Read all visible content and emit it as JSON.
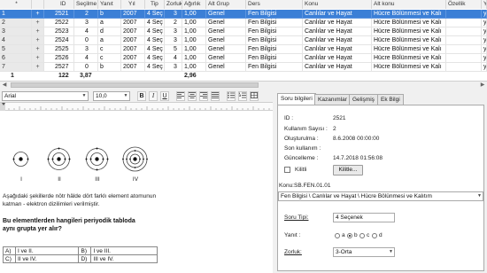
{
  "grid": {
    "headers": [
      "*",
      "ID",
      "Seçilme",
      "Yanıt",
      "Yıl",
      "Tip",
      "Zorluk",
      "Ağırlık",
      "Alt Grup",
      "Ders",
      "Konu",
      "Alt konu",
      "Özellik",
      "Y"
    ],
    "rows": [
      {
        "idx": "1",
        "plus": "+",
        "id": "2521",
        "secilme": "2",
        "yanit": "b",
        "yil": "2007",
        "tip": "4 Seç",
        "zorluk": "3",
        "agirlik": "1,00",
        "altgrup": "Genel",
        "ders": "Fen Bilgisi",
        "konu": "Canlılar ve Hayat",
        "altkonu": "Hücre Bölünmesi ve Kalı",
        "ozellik": "",
        "y": "ya"
      },
      {
        "idx": "2",
        "plus": "+",
        "id": "2522",
        "secilme": "3",
        "yanit": "a",
        "yil": "2007",
        "tip": "4 Seç",
        "zorluk": "2",
        "agirlik": "1,00",
        "altgrup": "Genel",
        "ders": "Fen Bilgisi",
        "konu": "Canlılar ve Hayat",
        "altkonu": "Hücre Bölünmesi ve Kalı",
        "ozellik": "",
        "y": "ya"
      },
      {
        "idx": "3",
        "plus": "+",
        "id": "2523",
        "secilme": "4",
        "yanit": "d",
        "yil": "2007",
        "tip": "4 Seç",
        "zorluk": "3",
        "agirlik": "1,00",
        "altgrup": "Genel",
        "ders": "Fen Bilgisi",
        "konu": "Canlılar ve Hayat",
        "altkonu": "Hücre Bölünmesi ve Kalı",
        "ozellik": "",
        "y": "ya"
      },
      {
        "idx": "4",
        "plus": "+",
        "id": "2524",
        "secilme": "0",
        "yanit": "a",
        "yil": "2007",
        "tip": "4 Seç",
        "zorluk": "3",
        "agirlik": "1,00",
        "altgrup": "Genel",
        "ders": "Fen Bilgisi",
        "konu": "Canlılar ve Hayat",
        "altkonu": "Hücre Bölünmesi ve Kalı",
        "ozellik": "",
        "y": "ya"
      },
      {
        "idx": "5",
        "plus": "+",
        "id": "2525",
        "secilme": "3",
        "yanit": "c",
        "yil": "2007",
        "tip": "4 Seç",
        "zorluk": "5",
        "agirlik": "1,00",
        "altgrup": "Genel",
        "ders": "Fen Bilgisi",
        "konu": "Canlılar ve Hayat",
        "altkonu": "Hücre Bölünmesi ve Kalı",
        "ozellik": "",
        "y": "ya"
      },
      {
        "idx": "6",
        "plus": "+",
        "id": "2526",
        "secilme": "4",
        "yanit": "c",
        "yil": "2007",
        "tip": "4 Seç",
        "zorluk": "4",
        "agirlik": "1,00",
        "altgrup": "Genel",
        "ders": "Fen Bilgisi",
        "konu": "Canlılar ve Hayat",
        "altkonu": "Hücre Bölünmesi ve Kalı",
        "ozellik": "",
        "y": "ya"
      },
      {
        "idx": "7",
        "plus": "+",
        "id": "2527",
        "secilme": "0",
        "yanit": "b",
        "yil": "2007",
        "tip": "4 Seç",
        "zorluk": "3",
        "agirlik": "1,00",
        "altgrup": "Genel",
        "ders": "Fen Bilgisi",
        "konu": "Canlılar ve Hayat",
        "altkonu": "Hücre Bölünmesi ve Kalı",
        "ozellik": "",
        "y": "ya"
      }
    ],
    "totals": {
      "idx": "1",
      "id": "122",
      "secilme": "3,87",
      "agirlik": "2,96"
    },
    "selected_row": 0
  },
  "editor": {
    "font": "Arial",
    "size": "10,0",
    "bold": "B",
    "italic": "I",
    "underline": "U",
    "atom_labels": [
      "I",
      "II",
      "III",
      "IV"
    ],
    "stem": "Aşağıdaki şekillerde nötr hâlde dört farklı element atomunun katman - elektron dizilimleri verilmiştir.",
    "question": "Bu elementlerden hangileri periyodik tabloda aynı grupta yer alır?",
    "options": [
      [
        "A)",
        "I ve II.",
        "B)",
        "I ve III."
      ],
      [
        "C)",
        "II ve IV.",
        "D)",
        "III ve IV."
      ]
    ]
  },
  "panel": {
    "tabs": [
      "Soru bilgileri",
      "Kazanımlar",
      "Gelişmiş",
      "Ek Bilgi"
    ],
    "active_tab": 0,
    "id_label": "ID :",
    "id_value": "2521",
    "usage_label": "Kullanım Sayısı :",
    "usage_value": "2",
    "created_label": "Oluşturulma :",
    "created_value": "8.6.2008 00:00:00",
    "lastuse_label": "Son kullanım :",
    "lastuse_value": "",
    "updated_label": "Güncelleme :",
    "updated_value": "14.7.2018 01:56:08",
    "lock_label": "Kilitli",
    "lock_button": "Kilitle...",
    "subject_code": "Konu:SB.FEN.01.01",
    "subject_path": "Fen Bilgisi \\ Canlılar ve Hayat \\ Hücre Bölünmesi ve Kalıtım",
    "type_label": "Soru Tipi:",
    "type_value": "4 Seçenek",
    "answer_label": "Yanıt :",
    "answer_options": [
      "a",
      "b",
      "c",
      "d"
    ],
    "answer_selected": "b",
    "difficulty_label": "Zorluk:",
    "difficulty_value": "3-Orta"
  }
}
